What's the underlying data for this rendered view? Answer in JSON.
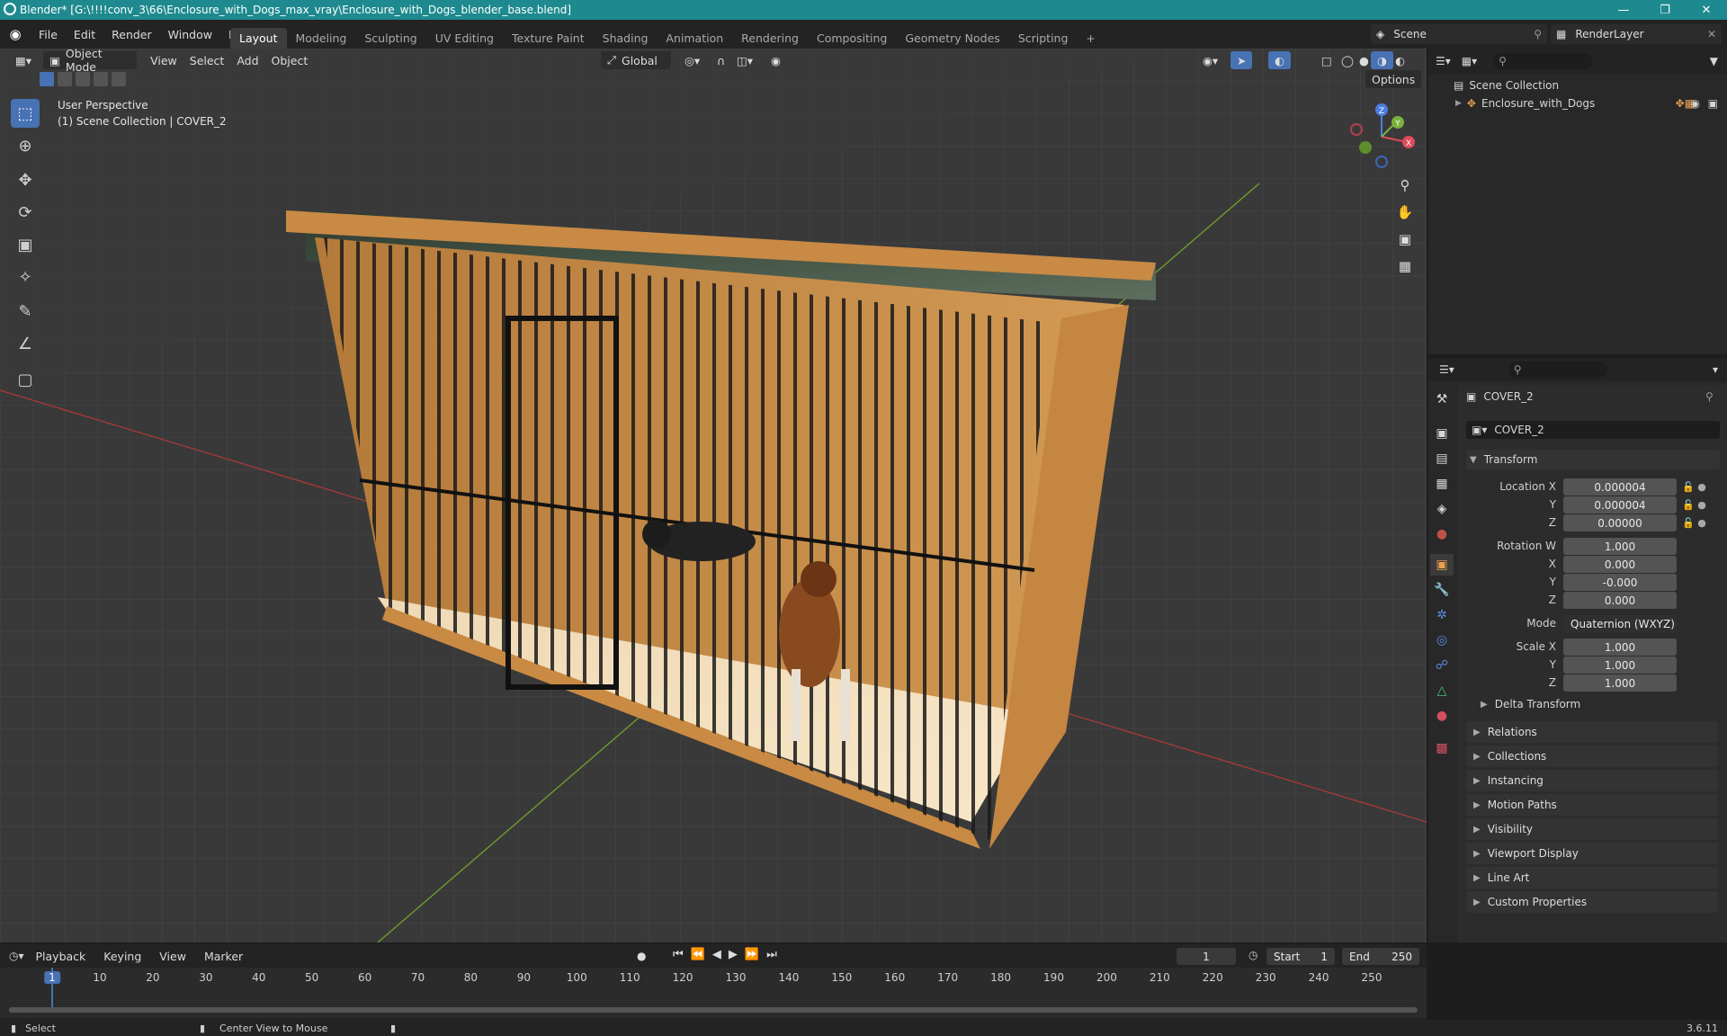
{
  "window": {
    "title": "Blender* [G:\\!!!!conv_3\\66\\Enclosure_with_Dogs_max_vray\\Enclosure_with_Dogs_blender_base.blend]"
  },
  "menu": [
    "File",
    "Edit",
    "Render",
    "Window",
    "Help"
  ],
  "workspaces": [
    "Layout",
    "Modeling",
    "Sculpting",
    "UV Editing",
    "Texture Paint",
    "Shading",
    "Animation",
    "Rendering",
    "Compositing",
    "Geometry Nodes",
    "Scripting"
  ],
  "active_workspace": "Layout",
  "scene": {
    "name": "Scene",
    "render_layer": "RenderLayer"
  },
  "viewport_header": {
    "mode": "Object Mode",
    "menus": [
      "View",
      "Select",
      "Add",
      "Object"
    ],
    "orientation": "Global",
    "options": "Options"
  },
  "viewport_overlay": {
    "perspective": "User Perspective",
    "context": "(1) Scene Collection | COVER_2"
  },
  "gizmo": {
    "x": "X",
    "y": "Y",
    "z": "Z"
  },
  "outliner": {
    "root": "Scene Collection",
    "items": [
      {
        "name": "Enclosure_with_Dogs"
      }
    ]
  },
  "properties": {
    "object_name": "COVER_2",
    "datablock": "COVER_2",
    "transform_label": "Transform",
    "location": {
      "label": "Location X",
      "x": "0.000004",
      "y": "0.000004",
      "z": "0.00000"
    },
    "rotation": {
      "label": "Rotation W",
      "w": "1.000",
      "x": "0.000",
      "y": "-0.000",
      "z": "0.000"
    },
    "mode": {
      "label": "Mode",
      "value": "Quaternion (WXYZ)"
    },
    "scale": {
      "label": "Scale X",
      "x": "1.000",
      "y": "1.000",
      "z": "1.000"
    },
    "axis_labels": {
      "y": "Y",
      "z": "Z",
      "x": "X"
    },
    "delta_transform": "Delta Transform",
    "panels": [
      "Relations",
      "Collections",
      "Instancing",
      "Motion Paths",
      "Visibility",
      "Viewport Display",
      "Line Art",
      "Custom Properties"
    ]
  },
  "timeline": {
    "menus": [
      "Playback",
      "Keying",
      "View",
      "Marker"
    ],
    "current_frame": "1",
    "start_label": "Start",
    "start": "1",
    "end_label": "End",
    "end": "250",
    "ticks": [
      "1",
      "10",
      "20",
      "30",
      "40",
      "50",
      "60",
      "70",
      "80",
      "90",
      "100",
      "110",
      "120",
      "130",
      "140",
      "150",
      "160",
      "170",
      "180",
      "190",
      "200",
      "210",
      "220",
      "230",
      "240",
      "250"
    ]
  },
  "status": {
    "left": "Select",
    "middle": "Center View to Mouse",
    "version": "3.6.11"
  }
}
